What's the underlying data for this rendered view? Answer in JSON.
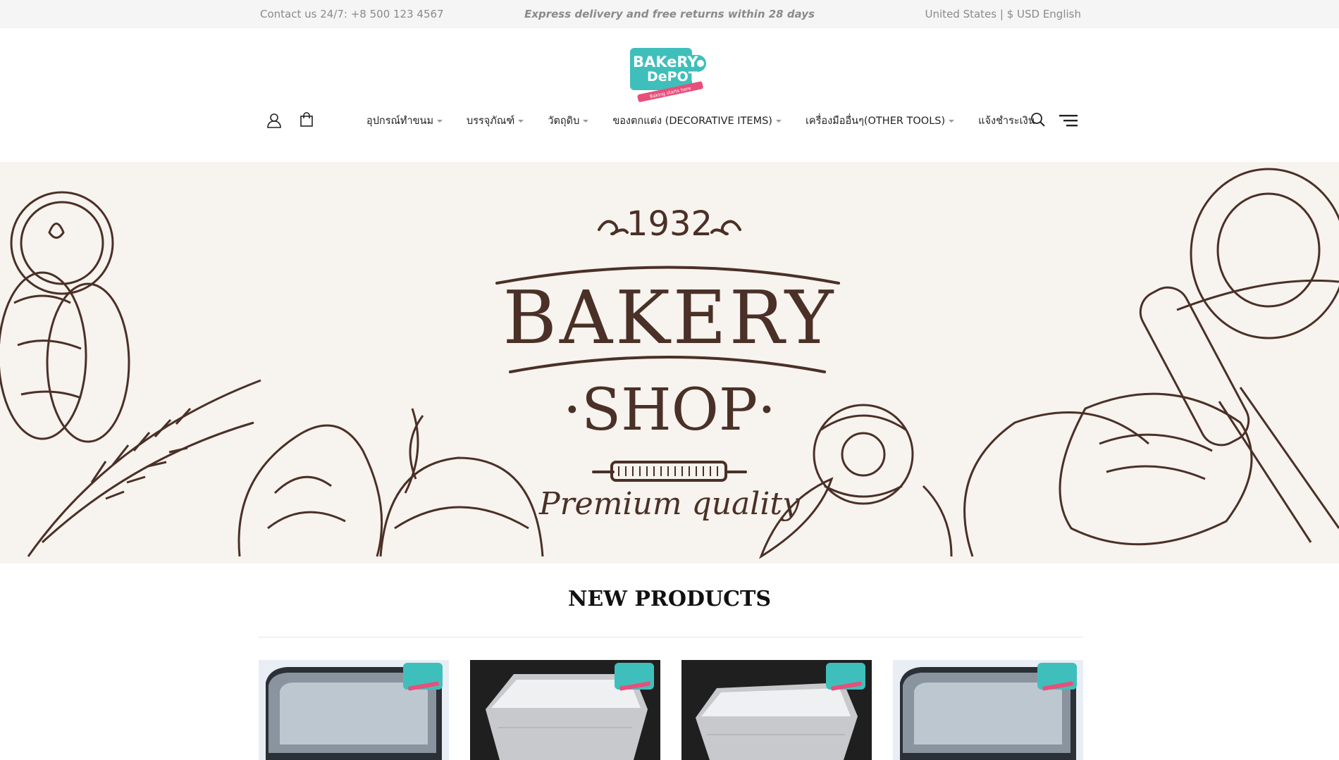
{
  "topbar": {
    "contact": "Contact us 24/7: +8 500 123 4567",
    "promo": "Express delivery and free returns within 28 days",
    "locale": "United States | $ USD English"
  },
  "logo": {
    "line1": "BAKeRY",
    "line2": "DePOT",
    "ribbon": "Baking starts here",
    "brand_color": "#3fbfbb",
    "ribbon_color": "#e84f7a"
  },
  "header": {
    "account_icon": "user-icon",
    "cart_icon": "shopping-bag-icon",
    "search_icon": "search-icon",
    "menu_icon": "hamburger-menu-icon"
  },
  "nav": {
    "items": [
      {
        "label": "อุปกรณ์ทำขนม",
        "has_dropdown": true
      },
      {
        "label": "บรรจุภัณฑ์",
        "has_dropdown": true
      },
      {
        "label": "วัตถุดิบ",
        "has_dropdown": true
      },
      {
        "label": "ของตกแต่ง (DECORATIVE ITEMS)",
        "has_dropdown": true
      },
      {
        "label": "เครื่องมืออื่นๆ(OTHER TOOLS)",
        "has_dropdown": true
      },
      {
        "label": "แจ้งชำระเงิน",
        "has_dropdown": false
      }
    ]
  },
  "hero": {
    "year": "1932",
    "title": "BAKERY",
    "subtitle": "·SHOP·",
    "tagline": "Premium quality",
    "ink_color": "#4a3027",
    "bg_color": "#f7f3ee"
  },
  "new_products": {
    "title": "NEW PRODUCTS",
    "items": [
      {
        "name": "black-base-container-product"
      },
      {
        "name": "clear-container-product"
      },
      {
        "name": "clear-container-product"
      },
      {
        "name": "black-base-container-product"
      }
    ]
  }
}
